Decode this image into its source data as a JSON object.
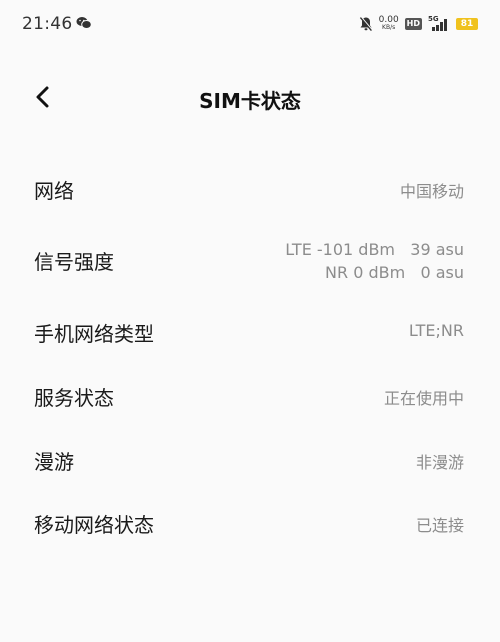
{
  "status_bar": {
    "time": "21:46",
    "net_speed_value": "0.00",
    "net_speed_unit": "KB/s",
    "hd_badge": "HD",
    "network_generation": "5G",
    "battery_level": "81",
    "battery_color": "#f0c21e",
    "icons": [
      "wechat-icon",
      "mute-icon",
      "signal-icon",
      "battery-icon"
    ]
  },
  "header": {
    "title": "SIM卡状态",
    "back_icon": "chevron-left-icon"
  },
  "rows": [
    {
      "label": "网络",
      "value": "中国移动"
    },
    {
      "label": "信号强度",
      "value_lines": [
        "LTE -101 dBm   39 asu",
        "NR 0 dBm   0 asu"
      ]
    },
    {
      "label": "手机网络类型",
      "value": "LTE;NR"
    },
    {
      "label": "服务状态",
      "value": "正在使用中"
    },
    {
      "label": "漫游",
      "value": "非漫游"
    },
    {
      "label": "移动网络状态",
      "value": "已连接"
    }
  ]
}
